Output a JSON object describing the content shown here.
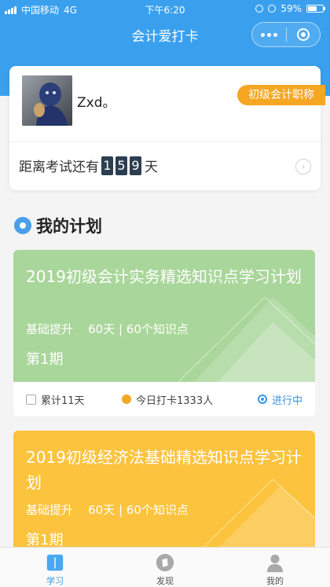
{
  "status_bar": {
    "carrier": "中国移动",
    "network": "4G",
    "time": "下午6:20",
    "battery": "59%",
    "battery_level": 0.59
  },
  "navbar": {
    "title": "会计爱打卡"
  },
  "profile": {
    "username": "Zxd。",
    "badge": "初级会计职称",
    "countdown_prefix": "距离考试还有",
    "countdown_digits": [
      "1",
      "5",
      "9"
    ],
    "countdown_suffix": "天"
  },
  "section": {
    "title": "我的计划"
  },
  "plans": [
    {
      "title": "2019初级会计实务精选知识点学习计划",
      "level": "基础提升",
      "duration": "60天 | 60个知识点",
      "period": "第1期",
      "stat_total": "累计11天",
      "stat_today": "今日打卡1333人",
      "status": "进行中",
      "color": "#a9d69a"
    },
    {
      "title": "2019初级经济法基础精选知识点学习计划",
      "level": "基础提升",
      "duration": "60天 | 60个知识点",
      "period": "第1期",
      "color": "#fcc33e"
    }
  ],
  "tabbar": [
    {
      "label": "学习",
      "icon": "book-icon",
      "active": true
    },
    {
      "label": "发现",
      "icon": "compass-icon",
      "active": false
    },
    {
      "label": "我的",
      "icon": "person-icon",
      "active": false
    }
  ],
  "colors": {
    "primary": "#3aa0ee",
    "accent": "#f5a623",
    "status_active": "#3a95e6"
  }
}
